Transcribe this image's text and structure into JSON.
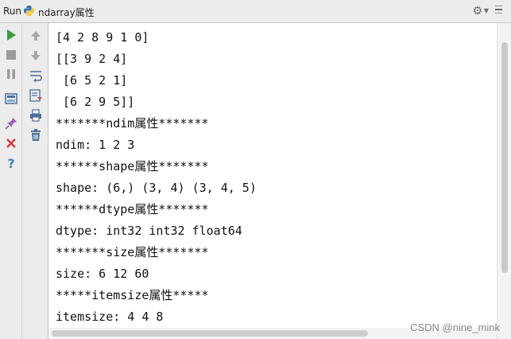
{
  "titlebar": {
    "run_label": "Run",
    "config_name": "ndarray属性",
    "icons": [
      "python-icon",
      "gear-icon",
      "chevron-down-icon",
      "minimize-icon"
    ]
  },
  "left_toolbar": [
    "run-icon",
    "stop-icon",
    "pause-icon",
    "layout-icon",
    "pin-icon",
    "close-icon",
    "help-icon"
  ],
  "inner_toolbar": [
    "up-arrow-icon",
    "down-arrow-icon",
    "soft-wrap-icon",
    "scroll-to-end-icon",
    "print-icon",
    "trash-icon"
  ],
  "console": {
    "lines": [
      "[4 2 8 9 1 0]",
      "[[3 9 2 4]",
      " [6 5 2 1]",
      " [6 2 9 5]]",
      "*******ndim属性*******",
      "ndim: 1 2 3",
      "******shape属性*******",
      "shape: (6,) (3, 4) (3, 4, 5)",
      "******dtype属性*******",
      "dtype: int32 int32 float64",
      "*******size属性*******",
      "size: 6 12 60",
      "*****itemsize属性*****",
      "itemsize: 4 4 8"
    ]
  },
  "watermark": "CSDN @nine_mink",
  "colors": {
    "run_green": "#3c9a3c",
    "stop_gray": "#8c8c8c",
    "close_red": "#d23a3a",
    "help_blue": "#3f7fc0",
    "pin_purple": "#9b5bbd"
  }
}
